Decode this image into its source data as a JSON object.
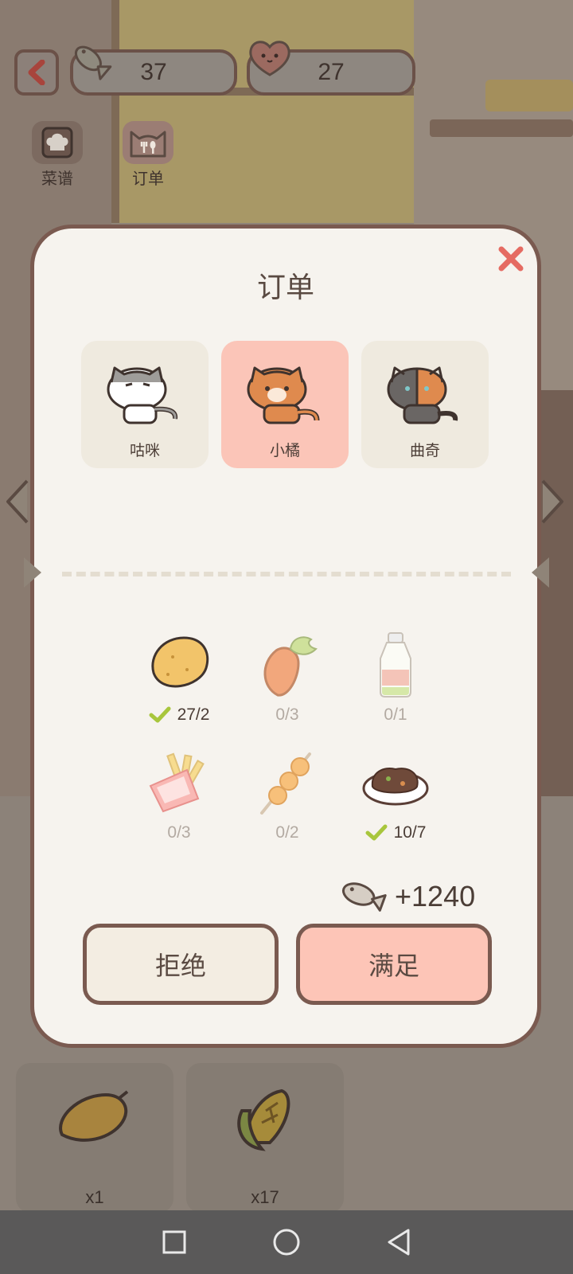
{
  "hud": {
    "fish_count": "37",
    "heart_count": "27",
    "recipes_label": "菜谱",
    "orders_label": "订单"
  },
  "modal": {
    "title": "订单",
    "cats": [
      {
        "name": "咕咪",
        "selected": false
      },
      {
        "name": "小橘",
        "selected": true
      },
      {
        "name": "曲奇",
        "selected": false
      }
    ],
    "items": [
      {
        "icon": "potato-icon",
        "count": "27/2",
        "done": true
      },
      {
        "icon": "carrot-icon",
        "count": "0/3",
        "done": false
      },
      {
        "icon": "milk-bottle-icon",
        "count": "0/1",
        "done": false
      },
      {
        "icon": "fries-icon",
        "count": "0/3",
        "done": false
      },
      {
        "icon": "skewer-icon",
        "count": "0/2",
        "done": false
      },
      {
        "icon": "stew-plate-icon",
        "count": "10/7",
        "done": true
      }
    ],
    "reward": "+1240",
    "reject_label": "拒绝",
    "accept_label": "满足"
  },
  "inventory": [
    {
      "icon": "mango-icon",
      "count": "x1"
    },
    {
      "icon": "corn-icon",
      "count": "x17"
    }
  ],
  "colors": {
    "accent": "#fbc5b8",
    "border": "#7a5a50",
    "panel": "#f6f3ee",
    "check": "#a8c63c",
    "close": "#e56b62"
  }
}
